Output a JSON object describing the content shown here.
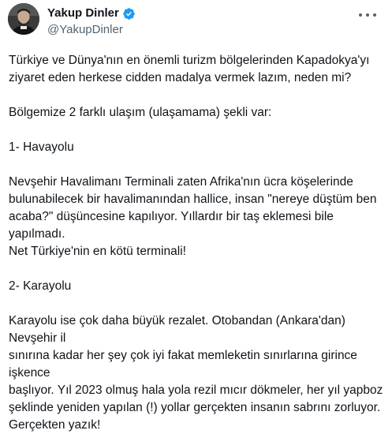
{
  "author": {
    "display_name": "Yakup Dinler",
    "handle": "@YakupDinler",
    "verified": true,
    "verified_color": "#1d9bf0"
  },
  "icons": {
    "verified": "verified-badge-icon",
    "more": "more-options-icon"
  },
  "tweet": {
    "paragraphs": [
      "Türkiye ve Dünya'nın en önemli turizm bölgelerinden Kapadokya'yı\nziyaret eden herkese cidden madalya vermek lazım, neden mi?",
      "Bölgemize 2 farklı ulaşım (ulaşamama) şekli var:",
      "1- Havayolu",
      "Nevşehir Havalimanı Terminali zaten Afrika'nın ücra köşelerinde\nbulunabilecek bir havalimanından hallice, insan \"nereye düştüm ben\nacaba?\" düşüncesine kapılıyor. Yıllardır bir taş eklemesi bile yapılmadı.\nNet Türkiye'nin en kötü terminali!",
      "2- Karayolu",
      "Karayolu ise çok daha büyük rezalet. Otobandan (Ankara'dan) Nevşehir il\nsınırına kadar her şey çok iyi fakat memleketin sınırlarına girince işkence\nbaşlıyor. Yıl 2023 olmuş hala yola rezil mıcır dökmeler, her yıl yapboz\nşeklinde yeniden yapılan (!) yollar gerçekten insanın sabrını zorluyor.\nGerçekten yazık!"
    ]
  }
}
